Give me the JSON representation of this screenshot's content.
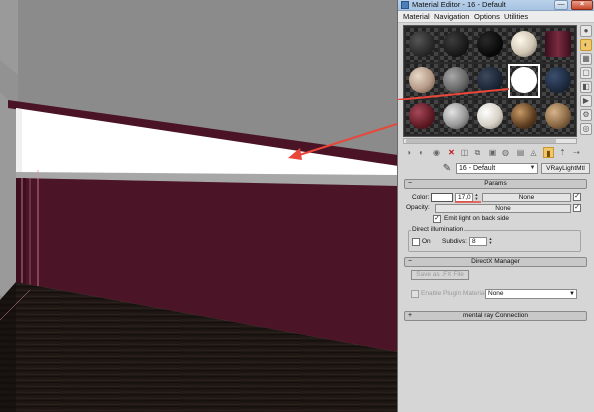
{
  "window": {
    "title": "Material Editor - 16 - Default",
    "close_glyph": "×",
    "min_glyph": "—"
  },
  "menu": [
    "Material",
    "Navigation",
    "Options",
    "Utilities"
  ],
  "slots": [
    {
      "icon": "dark-rough-sphere",
      "color": "#2a2a2a"
    },
    {
      "icon": "dark-sphere",
      "color": "#1c1c1c"
    },
    {
      "icon": "black-sphere",
      "color": "#0e0e0e"
    },
    {
      "icon": "beige-sphere",
      "color": "#cfc6b3"
    },
    {
      "icon": "wine-cylinder",
      "color": "#6a1e33"
    },
    {
      "icon": "brown-checker-sphere",
      "color": "#b59a87"
    },
    {
      "icon": "gray-sphere",
      "color": "#6b6b6b"
    },
    {
      "icon": "blue-dark-sphere",
      "color": "#1a2433"
    },
    {
      "icon": "white-light-sphere",
      "color": "#ffffff"
    },
    {
      "icon": "navy-pattern-sphere",
      "color": "#1d2a3f"
    },
    {
      "icon": "maroon-sphere",
      "color": "#5e1a22"
    },
    {
      "icon": "gray-metal-sphere",
      "color": "#9a9a9a"
    },
    {
      "icon": "stone-sphere",
      "color": "#d7d1c7"
    },
    {
      "icon": "wood-sphere",
      "color": "#5a3b1f"
    },
    {
      "icon": "tile-sphere",
      "color": "#8c6a45"
    }
  ],
  "side_tools": [
    "sample-type-icon",
    "backlight-icon",
    "background-icon",
    "uv-tiling-icon",
    "video-color-icon",
    "make-preview-icon",
    "options-icon",
    "select-by-material-icon",
    "material-navigator-icon"
  ],
  "toolbar": {
    "items": [
      "get-material-icon",
      "put-material-icon",
      "assign-material-icon",
      "reset-map-icon",
      "copy-material-icon",
      "make-unique-icon",
      "put-library-icon",
      "material-id-icon",
      "show-map-icon",
      "show-end-result-icon",
      "go-to-parent-icon",
      "go-forward-icon"
    ],
    "delete_glyph": "✕"
  },
  "name_row": {
    "material_name": "16 - Default",
    "material_type": "VRayLightMtl",
    "picker_glyph": "✎"
  },
  "params": {
    "header": "Params",
    "color_label": "Color:",
    "color_value": "17,0",
    "color_map": "None",
    "opacity_label": "Opacity:",
    "opacity_map": "None",
    "emit_back_label": "Emit light on back side",
    "emit_back_checked": "✓",
    "direct_group_title": "Direct illumination",
    "on_label": "On",
    "subdivs_label": "Subdivs:",
    "subdivs_value": "8"
  },
  "directx": {
    "header": "DirectX Manager",
    "save_fx_label": "Save as .FX File",
    "enable_plugin_label": "Enable Plugin Material",
    "plugin_select": "None"
  },
  "mental_ray": {
    "header": "mental ray Connection",
    "sign": "+"
  },
  "colors": {
    "wall_maroon": "#4d1528",
    "light_strip": "#ffffff",
    "floor_dark": "#1a1412",
    "arrow_red": "#e8473a"
  }
}
